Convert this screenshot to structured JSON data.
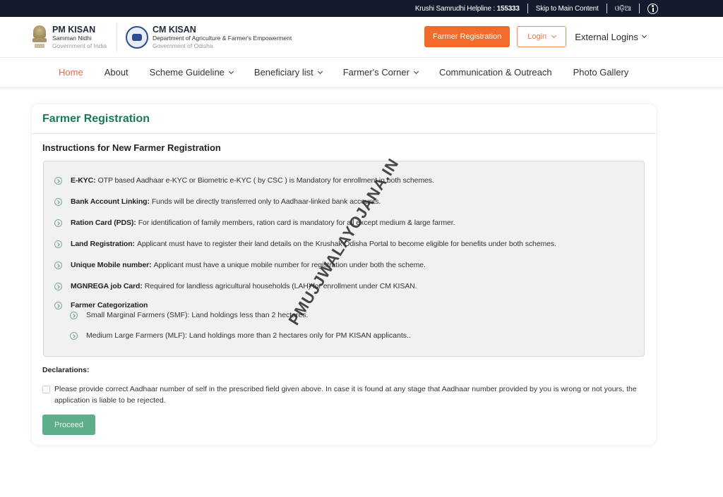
{
  "topbar": {
    "helpline_label": "Krushi Samrudhi Helpline :",
    "helpline_number": "155333",
    "skip_link": "Skip to Main Content",
    "language": "ଓଡ଼ିଆ",
    "accessibility_icon": "accessibility-icon"
  },
  "header": {
    "pm": {
      "title": "PM KISAN",
      "subtitle": "Samman Nidhi",
      "gov": "Government of India"
    },
    "cm": {
      "title": "CM KISAN",
      "subtitle": "Department of Agriculture & Farmer's Empowerment",
      "gov": "Government of Odisha"
    },
    "actions": {
      "farmer_registration": "Farmer Registration",
      "login": "Login",
      "external_logins": "External Logins"
    },
    "colors": {
      "accent": "#f26b2b",
      "topbar": "#141b2d",
      "green": "#1a7a55"
    }
  },
  "nav": {
    "items": [
      {
        "label": "Home",
        "active": true,
        "dropdown": false
      },
      {
        "label": "About",
        "dropdown": false
      },
      {
        "label": "Scheme Guideline",
        "dropdown": true
      },
      {
        "label": "Beneficiary list",
        "dropdown": true
      },
      {
        "label": "Farmer's Corner",
        "dropdown": true
      },
      {
        "label": "Communication & Outreach",
        "dropdown": false
      },
      {
        "label": "Photo Gallery",
        "dropdown": false
      }
    ]
  },
  "card": {
    "title": "Farmer Registration",
    "subtitle": "Instructions for New Farmer Registration",
    "instructions": [
      {
        "term": "E-KYC:",
        "text": "OTP based Aadhaar e-KYC or Biometric e-KYC ( by CSC ) is Mandatory for enrollment in both schemes."
      },
      {
        "term": "Bank Account Linking:",
        "text": "Funds will be directly transferred only to Aadhaar-linked bank accounts."
      },
      {
        "term": "Ration Card (PDS):",
        "text": "For identification of family members, ration card is mandatory for all except medium & large farmer."
      },
      {
        "term": "Land Registration:",
        "text": "Applicant must have to register their land details on the Krushak Odisha Portal to become eligible for benefits under both schemes."
      },
      {
        "term": "Unique Mobile number:",
        "text": "Applicant must have a unique mobile number for registration under both the scheme."
      },
      {
        "term": "MGNREGA job Card:",
        "text": "Required for landless agricultural households (LAH) for enrollment under CM KISAN."
      }
    ],
    "categorization": {
      "term": "Farmer Categorization",
      "items": [
        "Small Marginal Farmers (SMF): Land holdings less than 2 hectares.",
        "Medium Large Farmers (MLF): Land holdings more than 2 hectares only for PM KISAN applicants.."
      ]
    },
    "declarations_label": "Declarations:",
    "declaration_text": "Please provide correct Aadhaar number of self in the prescribed field given above. In case it is found at any stage that Aadhaar number provided by you is wrong or not yours, the application is liable to be rejected.",
    "declaration_checked": false,
    "proceed": "Proceed"
  },
  "watermark": "PMUJJWALAYOJANA.IN"
}
